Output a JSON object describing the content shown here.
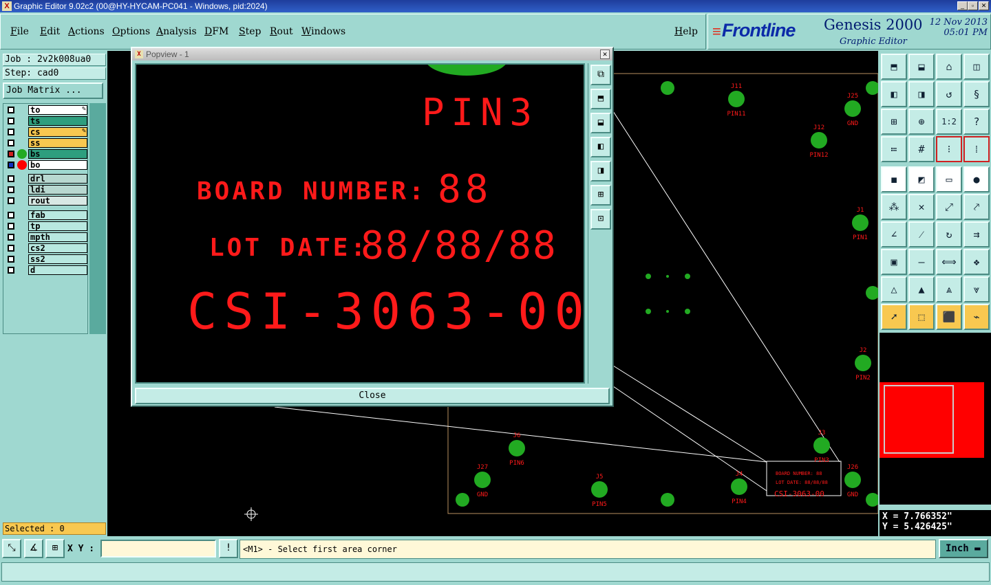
{
  "window": {
    "title": "Graphic Editor 9.02c2 (00@HY-HYCAM-PC041 - Windows, pid:2024)"
  },
  "menu": [
    "File",
    "Edit",
    "Actions",
    "Options",
    "Analysis",
    "DFM",
    "Step",
    "Rout",
    "Windows"
  ],
  "help_label": "Help",
  "brand": {
    "logo": "Frontline",
    "product": "Genesis 2000",
    "subtitle": "Graphic Editor",
    "date": "12 Nov 2013",
    "time": "05:01 PM"
  },
  "job": {
    "job_label": "Job : 2v2k008ua0",
    "step_label": "Step: cad0",
    "matrix_button": "Job Matrix ..."
  },
  "layers": [
    {
      "name": "to",
      "color": "#ffffff",
      "icon": "pen-icon"
    },
    {
      "name": "ts",
      "color": "#2e9e7e"
    },
    {
      "name": "cs",
      "color": "#f8c850",
      "icon": "pen-icon"
    },
    {
      "name": "ss",
      "color": "#f8c850"
    },
    {
      "name": "bs",
      "color": "#2e9e7e",
      "dot": "#22aa22",
      "checked": true
    },
    {
      "name": "bo",
      "color": "#ffffff",
      "dot": "#ff0000",
      "checked": true,
      "work": true
    },
    {
      "name": "drl",
      "color": "#b8d8d0"
    },
    {
      "name": "ldi",
      "color": "#b8d8d0"
    },
    {
      "name": "rout",
      "color": "#d8e8e4"
    },
    {
      "name": "fab",
      "color": "#b8e8e0"
    },
    {
      "name": "tp",
      "color": "#b8e8e0"
    },
    {
      "name": "mpth",
      "color": "#b8e8e0"
    },
    {
      "name": "cs2",
      "color": "#b8e8e0"
    },
    {
      "name": "ss2",
      "color": "#b8e8e0"
    },
    {
      "name": "d",
      "color": "#b8e8e0"
    }
  ],
  "selected_label": "Selected : 0",
  "popup": {
    "title": "Popview - 1",
    "close_label": "Close",
    "texts": {
      "pin3": "PIN3",
      "board_number": "BOARD NUMBER:",
      "board_value": "88",
      "lot_date": "LOT DATE:",
      "lot_value": "88/88/88",
      "part": "CSI-3063-00"
    }
  },
  "pads": [
    {
      "ref": "J11",
      "net": "PIN11"
    },
    {
      "ref": "J25",
      "net": "GND"
    },
    {
      "ref": "J12",
      "net": "PIN12"
    },
    {
      "ref": "J1",
      "net": "PIN1"
    },
    {
      "ref": "J2",
      "net": "PIN2"
    },
    {
      "ref": "J3",
      "net": "PIN3"
    },
    {
      "ref": "J6",
      "net": "PIN6"
    },
    {
      "ref": "J27",
      "net": "GND"
    },
    {
      "ref": "J5",
      "net": "PIN5"
    },
    {
      "ref": "J4",
      "net": "PIN4"
    },
    {
      "ref": "J26",
      "net": "GND"
    }
  ],
  "canvas_mini_text": {
    "board": "BOARD NUMBER: 88",
    "lot": "LOT DATE: 88/88/88",
    "part": "CSI-3063-00"
  },
  "coords": {
    "x": "X = 7.766352\"",
    "y": "Y = 5.426425\""
  },
  "bottom": {
    "xy_label": "X Y :",
    "xy_value": "",
    "message": "<M1> - Select first area corner",
    "units": "Inch"
  },
  "colors": {
    "panel": "#9fd8d0",
    "pad": "#22aa22",
    "silk": "#ff1a1a",
    "canvas": "#000000"
  }
}
